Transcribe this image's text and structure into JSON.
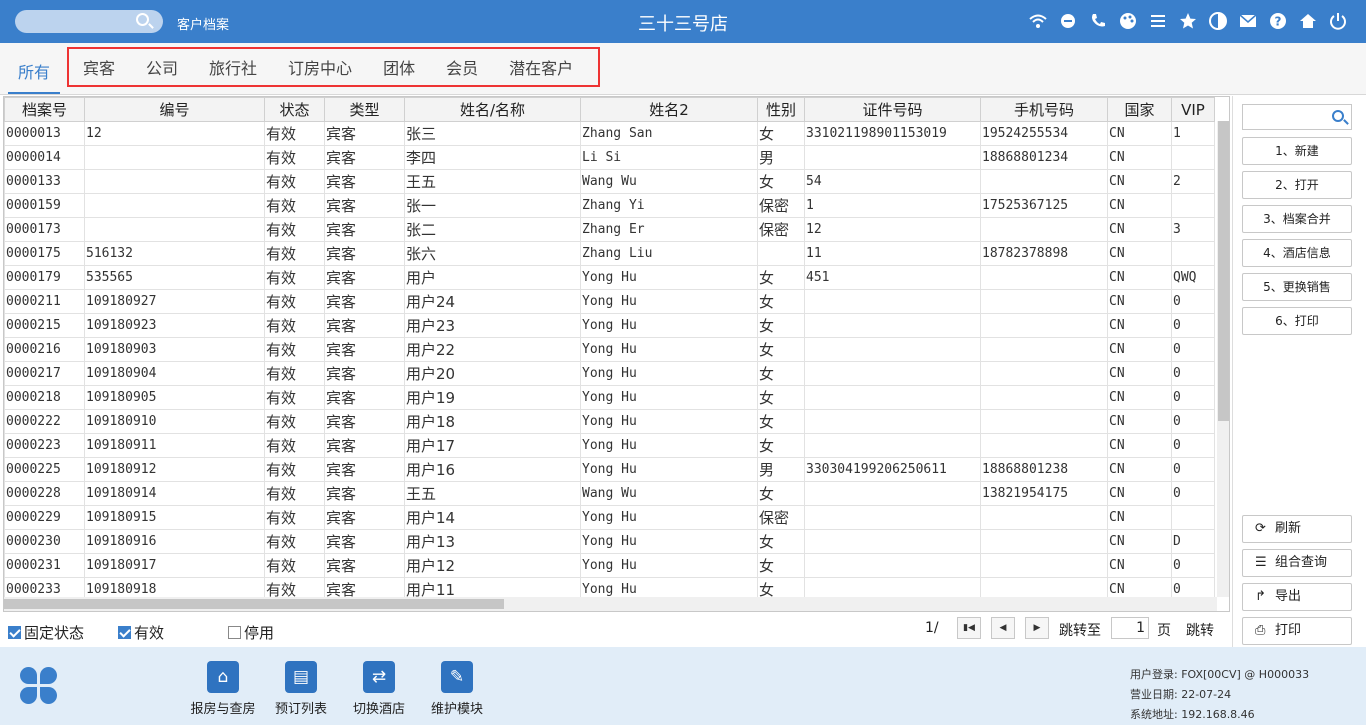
{
  "header": {
    "search_placeholder": "",
    "module_name": "客户档案",
    "hotel_title": "三十三号店",
    "icons": [
      "wifi-icon",
      "chat-icon",
      "phone-icon",
      "palette-icon",
      "menu-icon",
      "star-icon",
      "theme-icon",
      "mail-icon",
      "help-icon",
      "home-icon",
      "power-icon"
    ]
  },
  "tabs": {
    "active": "所有",
    "items": [
      "宾客",
      "公司",
      "旅行社",
      "订房中心",
      "团体",
      "会员",
      "潜在客户"
    ]
  },
  "grid": {
    "columns": [
      "档案号",
      "编号",
      "状态",
      "类型",
      "姓名/名称",
      "姓名2",
      "性别",
      "证件号码",
      "手机号码",
      "国家",
      "VIP"
    ],
    "rows": [
      [
        "0000013",
        "12",
        "有效",
        "宾客",
        "张三",
        "Zhang San",
        "女",
        "331021198901153019",
        "19524255534",
        "CN",
        "1"
      ],
      [
        "0000014",
        "",
        "有效",
        "宾客",
        "李四",
        "Li Si",
        "男",
        "",
        "18868801234",
        "CN",
        ""
      ],
      [
        "0000133",
        "",
        "有效",
        "宾客",
        "王五",
        "Wang Wu",
        "女",
        "54",
        "",
        "CN",
        "2"
      ],
      [
        "0000159",
        "",
        "有效",
        "宾客",
        "张一",
        "Zhang Yi",
        "保密",
        "1",
        "17525367125",
        "CN",
        ""
      ],
      [
        "0000173",
        "",
        "有效",
        "宾客",
        "张二",
        "Zhang Er",
        "保密",
        "12",
        "",
        "CN",
        "3"
      ],
      [
        "0000175",
        "516132",
        "有效",
        "宾客",
        "张六",
        "Zhang Liu",
        "",
        "11",
        "18782378898",
        "CN",
        ""
      ],
      [
        "0000179",
        "535565",
        "有效",
        "宾客",
        "用户",
        "Yong Hu",
        "女",
        "451",
        "",
        "CN",
        "QWQ"
      ],
      [
        "0000211",
        "109180927",
        "有效",
        "宾客",
        "用户24",
        "Yong Hu",
        "女",
        "",
        "",
        "CN",
        "0"
      ],
      [
        "0000215",
        "109180923",
        "有效",
        "宾客",
        "用户23",
        "Yong Hu",
        "女",
        "",
        "",
        "CN",
        "0"
      ],
      [
        "0000216",
        "109180903",
        "有效",
        "宾客",
        "用户22",
        "Yong Hu",
        "女",
        "",
        "",
        "CN",
        "0"
      ],
      [
        "0000217",
        "109180904",
        "有效",
        "宾客",
        "用户20",
        "Yong Hu",
        "女",
        "",
        "",
        "CN",
        "0"
      ],
      [
        "0000218",
        "109180905",
        "有效",
        "宾客",
        "用户19",
        "Yong Hu",
        "女",
        "",
        "",
        "CN",
        "0"
      ],
      [
        "0000222",
        "109180910",
        "有效",
        "宾客",
        "用户18",
        "Yong Hu",
        "女",
        "",
        "",
        "CN",
        "0"
      ],
      [
        "0000223",
        "109180911",
        "有效",
        "宾客",
        "用户17",
        "Yong Hu",
        "女",
        "",
        "",
        "CN",
        "0"
      ],
      [
        "0000225",
        "109180912",
        "有效",
        "宾客",
        "用户16",
        "Yong Hu",
        "男",
        "330304199206250611",
        "18868801238",
        "CN",
        "0"
      ],
      [
        "0000228",
        "109180914",
        "有效",
        "宾客",
        "王五",
        "Wang Wu",
        "女",
        "",
        "13821954175",
        "CN",
        "0"
      ],
      [
        "0000229",
        "109180915",
        "有效",
        "宾客",
        "用户14",
        "Yong Hu",
        "保密",
        "",
        "",
        "CN",
        ""
      ],
      [
        "0000230",
        "109180916",
        "有效",
        "宾客",
        "用户13",
        "Yong Hu",
        "女",
        "",
        "",
        "CN",
        "D"
      ],
      [
        "0000231",
        "109180917",
        "有效",
        "宾客",
        "用户12",
        "Yong Hu",
        "女",
        "",
        "",
        "CN",
        "0"
      ],
      [
        "0000233",
        "109180918",
        "有效",
        "宾客",
        "用户11",
        "Yong Hu",
        "女",
        "",
        "",
        "CN",
        "0"
      ]
    ]
  },
  "filters": {
    "fixed_status": {
      "label": "固定状态",
      "checked": true
    },
    "valid": {
      "label": "有效",
      "checked": true
    },
    "disabled": {
      "label": "停用",
      "checked": false
    }
  },
  "pager": {
    "page_info": "1/",
    "jump_label": "跳转至",
    "page_value": "1",
    "page_unit": "页",
    "jump_button": "跳转"
  },
  "sidebar": {
    "search_placeholder": "",
    "actions": [
      "1、新建",
      "2、打开",
      "3、档案合并",
      "4、酒店信息",
      "5、更换销售",
      "6、打印"
    ],
    "bottom_actions": [
      {
        "label": "刷新",
        "icon": "refresh-icon"
      },
      {
        "label": "组合查询",
        "icon": "list-icon"
      },
      {
        "label": "导出",
        "icon": "share-icon"
      },
      {
        "label": "打印",
        "icon": "printer-icon"
      }
    ]
  },
  "footer": {
    "buttons": [
      {
        "label": "报房与查房",
        "icon": "house-search-icon"
      },
      {
        "label": "预订列表",
        "icon": "booking-list-icon"
      },
      {
        "label": "切换酒店",
        "icon": "switch-icon"
      },
      {
        "label": "维护模块",
        "icon": "wrench-icon"
      }
    ],
    "user_login": "用户登录:  FOX[00CV] @ H000033",
    "business_date": "营业日期:  22-07-24",
    "system_address": "系统地址:  192.168.8.46"
  },
  "colors": {
    "primary": "#3a7fcb",
    "highlight_border": "#e33333",
    "footer_bg": "#e1edf8"
  }
}
